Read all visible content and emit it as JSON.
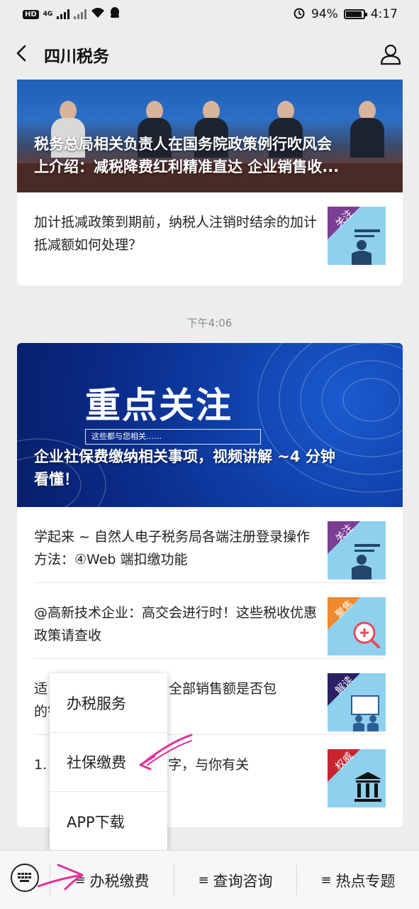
{
  "status_bar": {
    "left_badge": "HD",
    "network": "4G",
    "battery": "94%",
    "battery_level": 0.94,
    "time": "4:17"
  },
  "header": {
    "title": "四川税务"
  },
  "messages": [
    {
      "hero_title_line1": "税务总局相关负责人在国务院政策例行吹风会",
      "hero_title_line2": "上介绍：减税降费红利精准直达 企业销售收...",
      "items": [
        {
          "text": "加计抵减政策到期前，纳税人注销时结余的加计抵减额如何处理？",
          "thumb_tag": "关注",
          "thumb_icon": "teacher-icon"
        }
      ]
    },
    {
      "time": "下午4:06",
      "hero_big": "重点关注",
      "hero_sub": "这些都与您相关……",
      "hero_title_line1": "企业社保费缴纳相关事项，视频讲解 ~4 分钟",
      "hero_title_line2": "看懂！",
      "items": [
        {
          "text": "学起来 ~ 自然人电子税务局各端注册登录操作方法：④Web 端扣缴功能",
          "thumb_tag": "关注",
          "thumb_icon": "teacher-icon"
        },
        {
          "text": "@高新技术企业：高交会进行时！这些税收优惠政策请查收",
          "thumb_tag": "聚焦",
          "thumb_icon": "magnifier-icon"
        },
        {
          "text": "适　　　　　　　时，全部销售额是否包　　　　　　的销售额？",
          "thumb_tag": "解读",
          "thumb_icon": "presentation-icon"
        },
        {
          "text": "1.　　　　　！这些数字，与你有关",
          "thumb_tag": "权威",
          "thumb_icon": "courthouse-icon"
        }
      ]
    }
  ],
  "popup_menu": {
    "items": [
      "办税服务",
      "社保缴费",
      "APP下载"
    ]
  },
  "bottom_menu": {
    "items": [
      "办税缴费",
      "查询咨询",
      "热点专题"
    ]
  },
  "colors": {
    "background": "#ededed",
    "annotation": "#e0339b"
  }
}
